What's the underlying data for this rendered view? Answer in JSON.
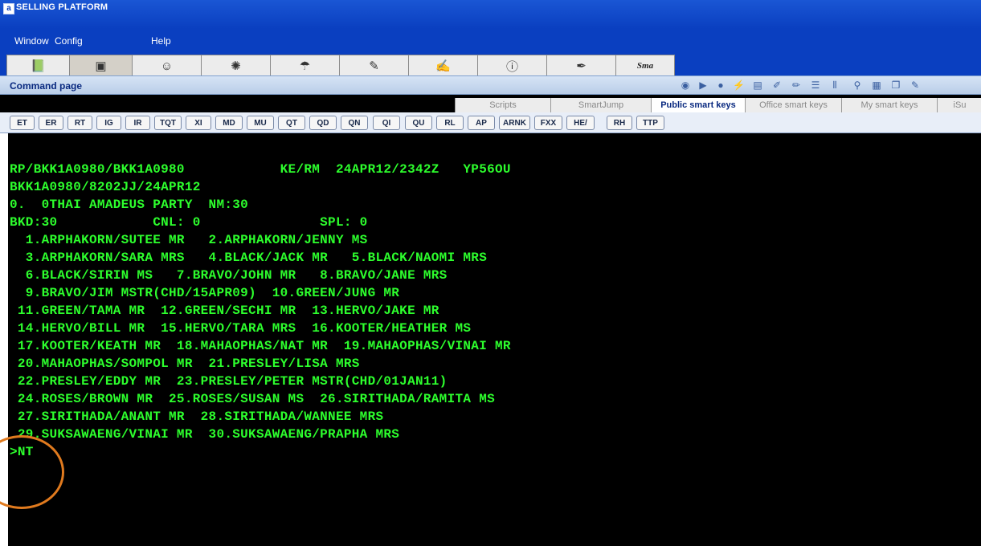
{
  "window": {
    "title": "SELLING PLATFORM",
    "icon": "amadeus-a-icon"
  },
  "menu": {
    "items": [
      "Window",
      "Config",
      "Help"
    ]
  },
  "toolbar": {
    "icons": [
      "book-icon",
      "terminal-icon",
      "agent-icon",
      "gear-sun-icon",
      "umbrella-icon",
      "tools-icon",
      "notepad-icon",
      "info-icon",
      "pen-icon",
      "smart-icon"
    ],
    "last_label": "Sma"
  },
  "command_page": {
    "title": "Command page",
    "icons": [
      "circle-icon",
      "play-icon",
      "record-icon",
      "wand-icon",
      "book-icon",
      "brush-icon",
      "highlighter-icon",
      "list-icon",
      "bars-icon",
      "magnify-icon",
      "grid-icon",
      "copy-icon",
      "edit-icon"
    ]
  },
  "tabs": [
    {
      "label": "Scripts",
      "active": false
    },
    {
      "label": "SmartJump",
      "active": false
    },
    {
      "label": "Public smart keys",
      "active": true
    },
    {
      "label": "Office smart keys",
      "active": false
    },
    {
      "label": "My smart keys",
      "active": false
    },
    {
      "label": "iSu",
      "active": false
    }
  ],
  "smart_keys": [
    "ET",
    "ER",
    "RT",
    "IG",
    "IR",
    "TQT",
    "XI",
    "MD",
    "MU",
    "QT",
    "QD",
    "QN",
    "QI",
    "QU",
    "RL",
    "AP",
    "ARNK",
    "FXX",
    "HE/",
    "RH",
    "TTP"
  ],
  "terminal": {
    "text_color": "#2dfe2d",
    "lines": [
      "RP/BKK1A0980/BKK1A0980            KE/RM  24APR12/2342Z   YP56OU",
      "BKK1A0980/8202JJ/24APR12",
      "0.  0THAI AMADEUS PARTY  NM:30",
      "BKD:30            CNL: 0               SPL: 0",
      "  1.ARPHAKORN/SUTEE MR   2.ARPHAKORN/JENNY MS",
      "  3.ARPHAKORN/SARA MRS   4.BLACK/JACK MR   5.BLACK/NAOMI MRS",
      "  6.BLACK/SIRIN MS   7.BRAVO/JOHN MR   8.BRAVO/JANE MRS",
      "  9.BRAVO/JIM MSTR(CHD/15APR09)  10.GREEN/JUNG MR",
      " 11.GREEN/TAMA MR  12.GREEN/SECHI MR  13.HERVO/JAKE MR",
      " 14.HERVO/BILL MR  15.HERVO/TARA MRS  16.KOOTER/HEATHER MS",
      " 17.KOOTER/KEATH MR  18.MAHAOPHAS/NAT MR  19.MAHAOPHAS/VINAI MR",
      " 20.MAHAOPHAS/SOMPOL MR  21.PRESLEY/LISA MRS",
      " 22.PRESLEY/EDDY MR  23.PRESLEY/PETER MSTR(CHD/01JAN11)",
      " 24.ROSES/BROWN MR  25.ROSES/SUSAN MS  26.SIRITHADA/RAMITA MS",
      " 27.SIRITHADA/ANANT MR  28.SIRITHADA/WANNEE MRS",
      " 29.SUKSAWAENG/VINAI MR  30.SUKSAWAENG/PRAPHA MRS",
      ">NT"
    ]
  },
  "annotation": {
    "color": "#e07a1e"
  }
}
